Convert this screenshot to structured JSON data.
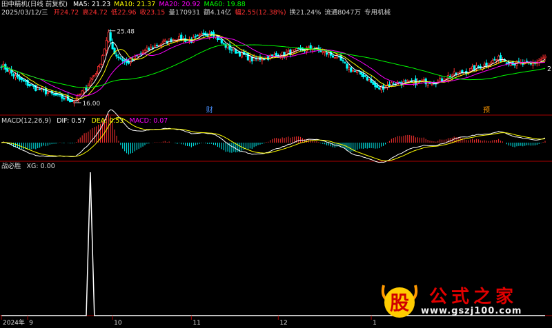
{
  "header": {
    "stock_title": "田中精机(日线 前复权)",
    "ma": [
      {
        "label": "MA5: 21.23",
        "color": "#ffffff"
      },
      {
        "label": "MA10: 21.37",
        "color": "#ffff00"
      },
      {
        "label": "MA20: 20.92",
        "color": "#ff00ff"
      },
      {
        "label": "MA60: 19.88",
        "color": "#00ff00"
      }
    ],
    "date": "2025/03/12/三",
    "quote": [
      {
        "label": "开24.72",
        "color": "#ff3030"
      },
      {
        "label": "高24.72",
        "color": "#ff3030"
      },
      {
        "label": "低22.96",
        "color": "#ff3030"
      },
      {
        "label": "收23.15",
        "color": "#ff3030"
      },
      {
        "label": "量170931",
        "color": "#cccccc"
      },
      {
        "label": "额4.14亿",
        "color": "#cccccc"
      },
      {
        "label": "幅2.55(12.38%)",
        "color": "#ff3030"
      },
      {
        "label": "换21.24%",
        "color": "#cccccc"
      },
      {
        "label": "流通8047万",
        "color": "#cccccc"
      },
      {
        "label": "专用机械",
        "color": "#cccccc"
      }
    ]
  },
  "macd_header": {
    "title": "MACD(12,26,9)",
    "dif": "DIF: 0.57",
    "dea": "DEA: 0.53",
    "macd": "MACD: 0.07",
    "macd_color": "#ff00ff"
  },
  "xg_header": {
    "title": "战必胜",
    "xg": "XG: 0.00"
  },
  "markers": {
    "high_label": "25.48",
    "low_label": "16.00",
    "cai": "财",
    "yu": "预"
  },
  "right_edge_label": "2",
  "x_axis": {
    "labels": [
      {
        "text": "2024年",
        "index": 0
      },
      {
        "text": "9",
        "index": 13
      },
      {
        "text": "10",
        "index": 55
      },
      {
        "text": "11",
        "index": 94
      },
      {
        "text": "12",
        "index": 137
      },
      {
        "text": "1",
        "index": 183
      }
    ]
  },
  "watermark": {
    "name": "公式之家",
    "url": "www.gszj100.com",
    "glyph": "股"
  },
  "chart_data": [
    {
      "type": "candlestick",
      "panel": "price",
      "ylim": [
        15,
        27
      ],
      "x_count": 270,
      "anchors": [
        [
          0,
          21.0
        ],
        [
          8,
          19.2
        ],
        [
          16,
          18.0
        ],
        [
          24,
          17.2
        ],
        [
          32,
          16.5
        ],
        [
          36,
          16.2
        ],
        [
          42,
          18.0
        ],
        [
          48,
          20.5
        ],
        [
          53,
          25.0
        ],
        [
          56,
          22.5
        ],
        [
          62,
          21.2
        ],
        [
          70,
          22.6
        ],
        [
          76,
          23.5
        ],
        [
          86,
          24.5
        ],
        [
          94,
          24.2
        ],
        [
          104,
          25.4
        ],
        [
          110,
          23.6
        ],
        [
          118,
          22.5
        ],
        [
          124,
          21.7
        ],
        [
          132,
          22.0
        ],
        [
          146,
          22.8
        ],
        [
          154,
          23.2
        ],
        [
          160,
          22.6
        ],
        [
          166,
          22.0
        ],
        [
          172,
          20.5
        ],
        [
          180,
          19.5
        ],
        [
          186,
          17.8
        ],
        [
          194,
          18.6
        ],
        [
          202,
          18.6
        ],
        [
          210,
          18.8
        ],
        [
          216,
          18.8
        ],
        [
          222,
          19.6
        ],
        [
          230,
          20.1
        ],
        [
          238,
          20.9
        ],
        [
          246,
          21.8
        ],
        [
          254,
          21.2
        ],
        [
          262,
          21.0
        ],
        [
          269,
          22.0
        ]
      ],
      "ma_series": [
        {
          "name": "MA5",
          "color": "#ffffff",
          "window": 5
        },
        {
          "name": "MA10",
          "color": "#ffff00",
          "window": 10
        },
        {
          "name": "MA20",
          "color": "#ff00ff",
          "window": 20
        },
        {
          "name": "MA60",
          "color": "#00ff00",
          "window": 60
        }
      ],
      "annotations": [
        {
          "text": "25.48",
          "x": 53,
          "y": 25.48
        },
        {
          "text": "16.00",
          "x": 36,
          "y": 16.0
        }
      ]
    },
    {
      "type": "macd",
      "panel": "macd",
      "ylim": [
        -0.9,
        0.9
      ]
    },
    {
      "type": "line",
      "panel": "xg",
      "ylim": [
        0,
        1
      ],
      "x": [
        0,
        42,
        44,
        46,
        269
      ],
      "values": [
        0,
        0,
        1,
        0,
        0
      ]
    }
  ]
}
